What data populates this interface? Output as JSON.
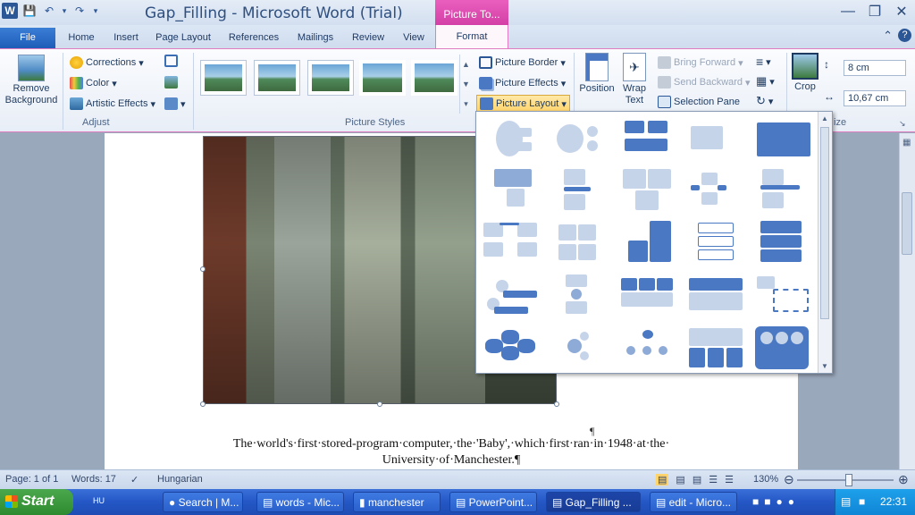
{
  "window": {
    "title": "Gap_Filling - Microsoft Word (Trial)",
    "contextual_group": "Picture To...",
    "app_icon": "W"
  },
  "tabs": [
    "File",
    "Home",
    "Insert",
    "Page Layout",
    "References",
    "Mailings",
    "Review",
    "View",
    "Format"
  ],
  "ribbon": {
    "remove_background": "Remove Background",
    "corrections": "Corrections",
    "color": "Color",
    "artistic_effects": "Artistic Effects",
    "adjust_label": "Adjust",
    "picture_styles_label": "Picture Styles",
    "picture_border": "Picture Border",
    "picture_effects": "Picture Effects",
    "picture_layout": "Picture Layout",
    "position": "Position",
    "wrap_text": "Wrap Text",
    "bring_forward": "Bring Forward",
    "send_backward": "Send Backward",
    "selection_pane": "Selection Pane",
    "crop": "Crop",
    "height": "8 cm",
    "width": "10,67 cm",
    "size_label": "ize"
  },
  "document": {
    "paragraph_mark": "¶",
    "caption_line1": "The·world's·first·stored-program·computer,·the·'Baby',·which·first·ran·in·1948·at·the·",
    "caption_line2": "University·of·Manchester.¶"
  },
  "status": {
    "page": "Page: 1 of 1",
    "words": "Words: 17",
    "language": "Hungarian",
    "zoom": "130%"
  },
  "taskbar": {
    "start": "Start",
    "lang": "HU",
    "tasks": [
      "Search | M...",
      "words - Mic...",
      "manchester",
      "PowerPoint...",
      "Gap_Filling ...",
      "edit - Micro..."
    ],
    "clock": "22:31"
  },
  "colors": {
    "accent_pink": "#d33fa6",
    "file_blue": "#1d5db8",
    "taskbar_blue": "#2457c5"
  }
}
